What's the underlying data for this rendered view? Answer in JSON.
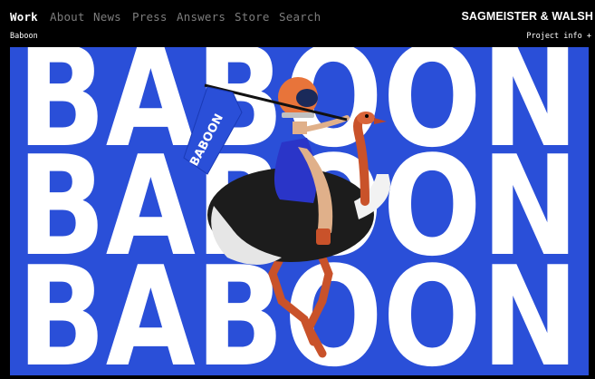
{
  "nav": {
    "items": [
      {
        "label": "Work",
        "active": true
      },
      {
        "label": "About",
        "active": false
      },
      {
        "label": "News",
        "active": false
      },
      {
        "label": "Press",
        "active": false
      },
      {
        "label": "Answers",
        "active": false
      },
      {
        "label": "Store",
        "active": false
      },
      {
        "label": "Search",
        "active": false
      }
    ],
    "brand": "SAGMEISTER & WALSH"
  },
  "project": {
    "title": "Baboon",
    "info_label": "Project info +"
  },
  "hero": {
    "word": "BABOON",
    "flag_text": "BABOON",
    "colors": {
      "background": "#2a4fd8",
      "letters": "#ffffff",
      "flag": "#2a4fd8",
      "helmet": "#e8743a",
      "ostrich_body": "#1c1c1c",
      "ostrich_legs": "#c9522a"
    },
    "image_subject": "woman in helmet riding an ostrich holding a BABOON flag"
  }
}
